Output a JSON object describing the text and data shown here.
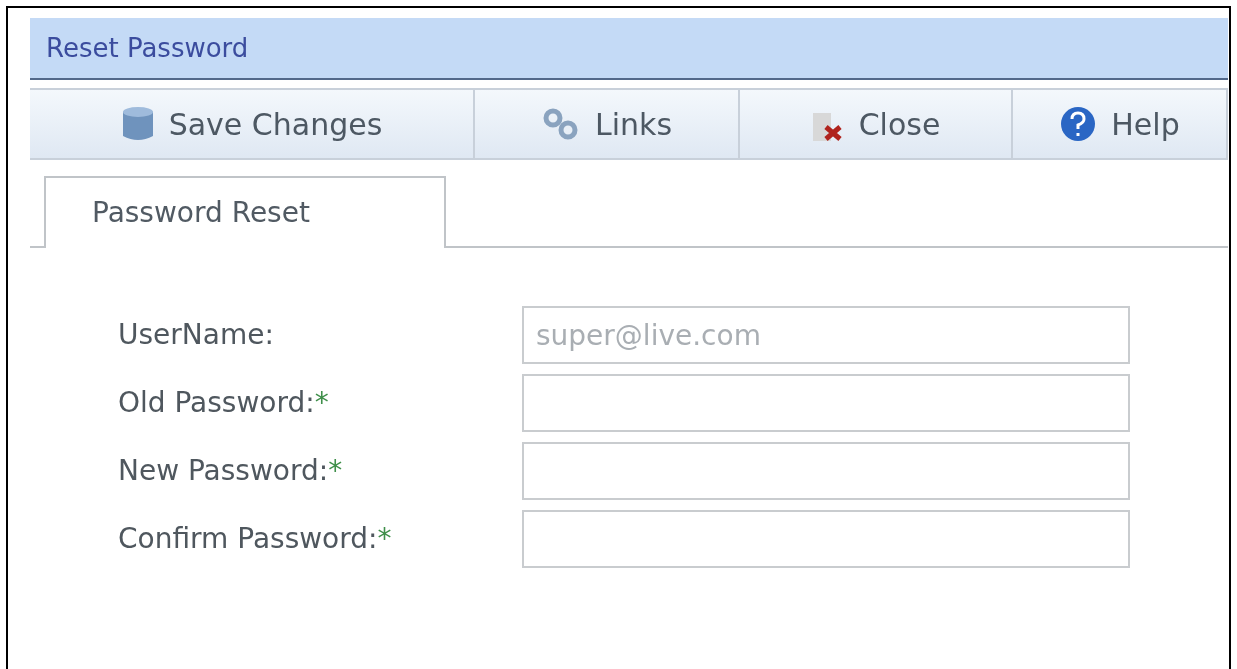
{
  "window": {
    "title": "Reset Password"
  },
  "toolbar": [
    {
      "label": "Save Changes"
    },
    {
      "label": "Links"
    },
    {
      "label": "Close"
    },
    {
      "label": "Help"
    }
  ],
  "tabs": [
    {
      "label": "Password Reset",
      "selected": true
    }
  ],
  "fields": [
    {
      "label": "UserName:",
      "value": "super@live.com",
      "disabled": true
    },
    {
      "label": "Old Password:",
      "required_mark": "*"
    },
    {
      "label": "New Password:",
      "required_mark": "*"
    },
    {
      "label": "Confirm Password:",
      "required_mark": "*"
    }
  ]
}
